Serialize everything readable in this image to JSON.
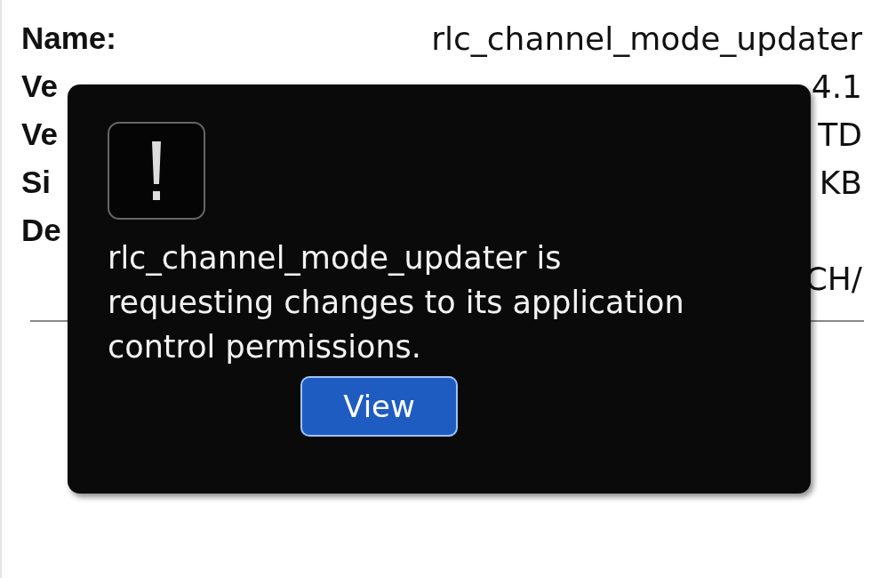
{
  "details": [
    {
      "label": "Name:",
      "value": "rlc_channel_mode_updater"
    },
    {
      "label": "Ve",
      "value": "4.1"
    },
    {
      "label": "Ve",
      "value": "TD"
    },
    {
      "label": "Si",
      "value": "KB"
    },
    {
      "label": "De"
    },
    {
      "value": "CH/"
    }
  ],
  "dialog": {
    "message": "rlc_channel_mode_updater is requesting changes to its application control permissions.",
    "buttons": [
      "View"
    ]
  }
}
